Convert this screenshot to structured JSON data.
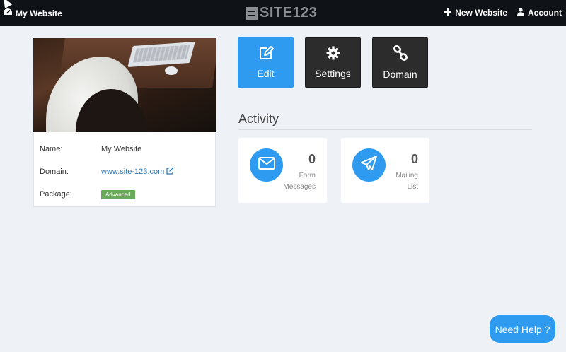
{
  "topbar": {
    "site_name": "My Website",
    "logo_text": "SITE123",
    "new_website_label": "New Website",
    "account_label": "Account"
  },
  "profile": {
    "name_key": "Name:",
    "name_value": "My Website",
    "domain_key": "Domain:",
    "domain_value": "www.site-123.com",
    "package_key": "Package:",
    "package_value": "Advanced"
  },
  "actions": {
    "edit_label": "Edit",
    "settings_label": "Settings",
    "domain_label": "Domain"
  },
  "activity": {
    "title": "Activity",
    "cards": [
      {
        "count": "0",
        "label_line1": "Form",
        "label_line2": "Messages",
        "icon": "envelope-icon"
      },
      {
        "count": "0",
        "label_line1": "Mailing",
        "label_line2": "List",
        "icon": "paper-plane-icon"
      }
    ]
  },
  "help": {
    "label": "Need Help ?"
  },
  "colors": {
    "accent": "#2f9bf0",
    "topbar": "#0f1217",
    "dark_tile": "#2c2c2c",
    "badge": "#6aa85b",
    "background": "#eef2f7",
    "link": "#2a78b8"
  }
}
